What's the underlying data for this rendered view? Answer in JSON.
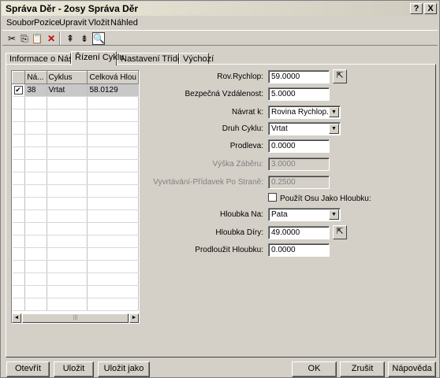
{
  "window": {
    "title": "Správa Děr - 2osy Správa Děr",
    "help_label": "?",
    "close_label": "X"
  },
  "menu": [
    "Soubor",
    "Pozice",
    "Upravit",
    "Vložit",
    "Náhled"
  ],
  "toolbar": {
    "icons": [
      "cut-icon",
      "copy-icon",
      "paste-icon",
      "delete-icon",
      "sort-up-icon",
      "sort-down-icon",
      "preview-icon"
    ],
    "glyphs": [
      "✂",
      "⎘",
      "📋",
      "✕",
      "⇞",
      "⇟",
      "🔍"
    ]
  },
  "tabs": [
    "Informace o Nástroji",
    "Řízení Cyklu",
    "Nastavení Třídění",
    "Výchozí"
  ],
  "active_tab": 1,
  "grid": {
    "headers": [
      "",
      "Ná...",
      "Cyklus",
      "Celková Hlou"
    ],
    "rows": [
      {
        "checked": true,
        "check_glyph": "✔",
        "num": "38",
        "cycle": "Vrtat",
        "depth": "58.0129"
      }
    ],
    "scroll_left": "◄",
    "scroll_right": "►",
    "thumb_grip": "|||"
  },
  "form": {
    "rapid_label": "Rov.Rychlop:",
    "rapid_value": "59.0000",
    "safe_label": "Bezpečná Vzdálenost:",
    "safe_value": "5.0000",
    "return_label": "Návrat k:",
    "return_value": "Rovina Rychlop.",
    "cycle_type_label": "Druh Cyklu:",
    "cycle_type_value": "Vrtat",
    "dwell_label": "Prodleva:",
    "dwell_value": "0.0000",
    "peck_label": "Výška Záběru:",
    "peck_value": "3.0000",
    "stepover_label": "Vyvrtávání-Přídavek Po Straně:",
    "stepover_value": "0.2500",
    "use_axis_label": "Použít Osu Jako Hloubku:",
    "depth_to_label": "Hloubka Na:",
    "depth_to_value": "Pata",
    "hole_depth_label": "Hloubka Díry:",
    "hole_depth_value": "49.0000",
    "extend_label": "Prodloužit Hloubku:",
    "extend_value": "0.0000",
    "dropdown_glyph": "▼",
    "pick_glyph": "⇱"
  },
  "buttons": {
    "open": "Otevřít",
    "save": "Uložit",
    "save_as": "Uložit jako",
    "ok": "OK",
    "cancel": "Zrušit",
    "help": "Nápověda"
  }
}
